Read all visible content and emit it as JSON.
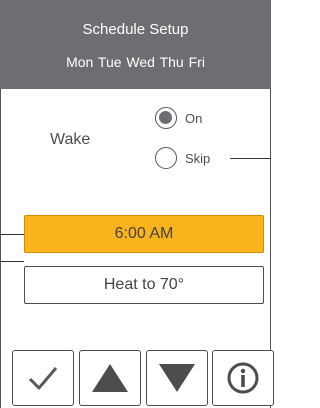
{
  "header": {
    "title": "Schedule Setup",
    "days": "Mon  Tue  Wed  Thu  Fri"
  },
  "period": {
    "label": "Wake",
    "options": [
      {
        "label": "On",
        "selected": true
      },
      {
        "label": "Skip",
        "selected": false
      }
    ]
  },
  "time": {
    "value": "6:00 AM"
  },
  "setpoint": {
    "value": "Heat to 70°"
  },
  "toolbar": {
    "buttons": [
      {
        "icon": "check-icon"
      },
      {
        "icon": "arrow-up-icon"
      },
      {
        "icon": "arrow-down-icon"
      },
      {
        "icon": "info-icon"
      }
    ]
  },
  "colors": {
    "header": "#6d6e71",
    "highlight": "#fbb31d",
    "dark": "#4d4d4d"
  }
}
